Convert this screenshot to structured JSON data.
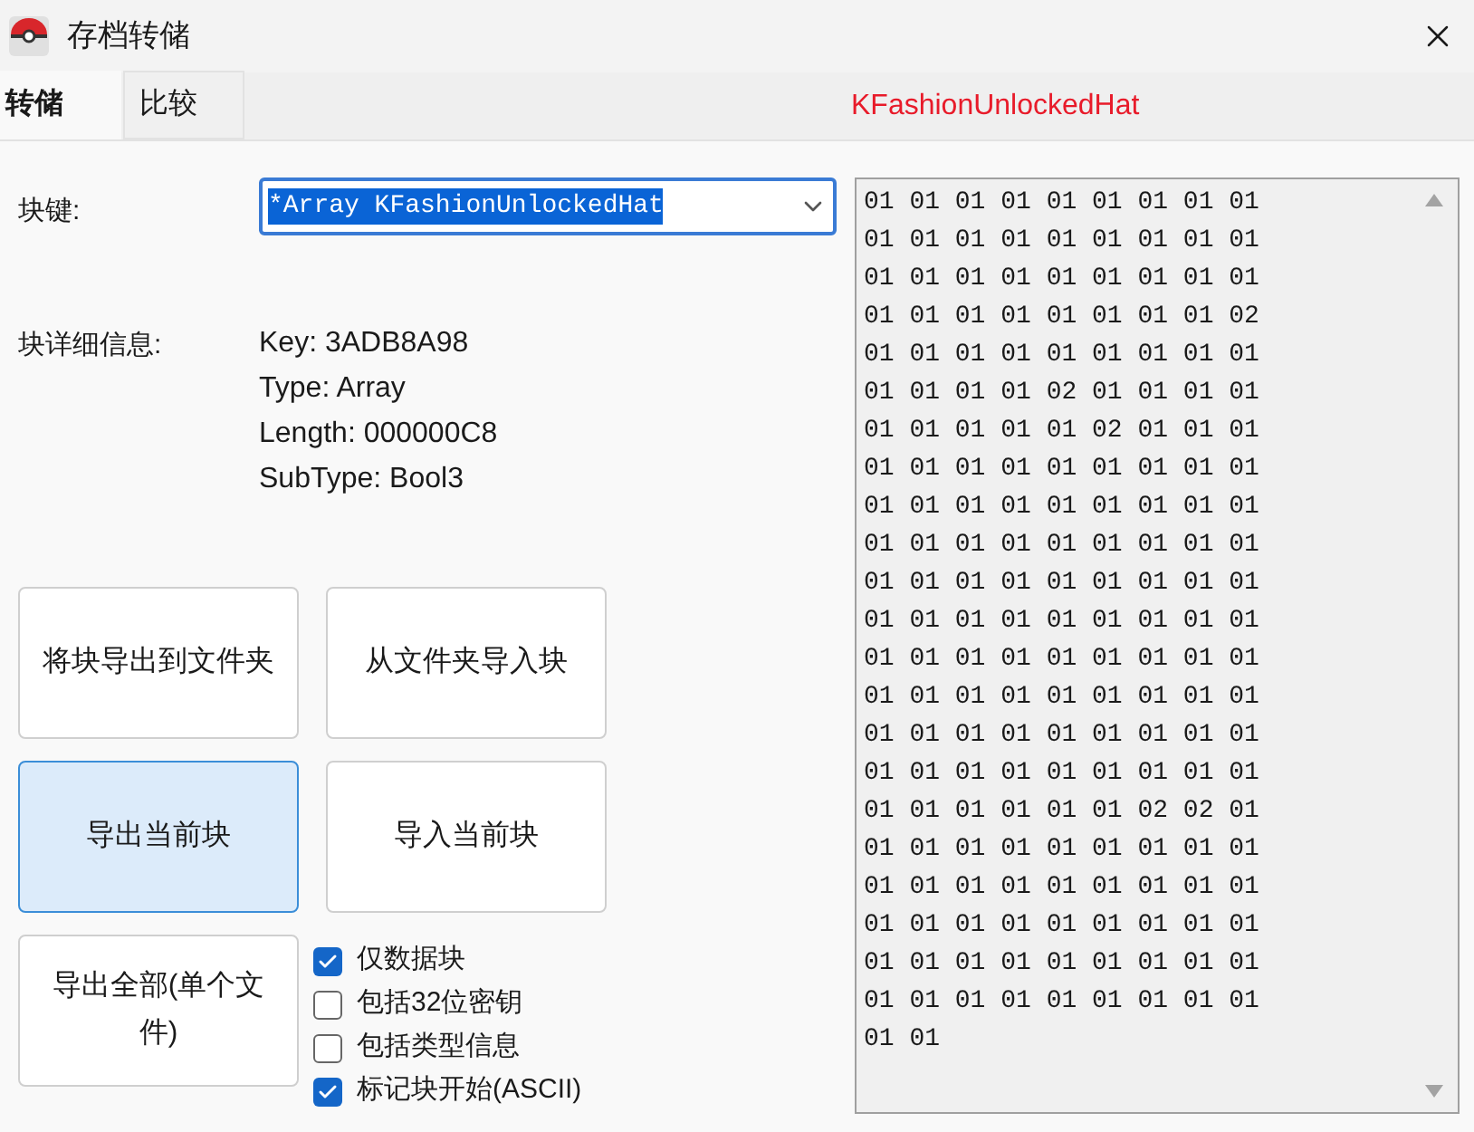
{
  "window": {
    "title": "存档转储"
  },
  "tabs": [
    {
      "label": "转储",
      "selected": true
    },
    {
      "label": "比较",
      "selected": false
    }
  ],
  "block_name": "KFashionUnlockedHat",
  "block_key": {
    "label": "块键:",
    "value": "*Array KFashionUnlockedHat"
  },
  "details": {
    "label": "块详细信息:",
    "lines": [
      "Key: 3ADB8A98",
      "Type: Array",
      "Length: 000000C8",
      "SubType: Bool3"
    ]
  },
  "buttons": [
    {
      "label": "将块导出到文件夹",
      "selected": false
    },
    {
      "label": "从文件夹导入块",
      "selected": false
    },
    {
      "label": "导出当前块",
      "selected": true
    },
    {
      "label": "导入当前块",
      "selected": false
    },
    {
      "label": "导出全部(单个文件)",
      "selected": false
    }
  ],
  "options": [
    {
      "label": "仅数据块",
      "checked": true
    },
    {
      "label": "包括32位密钥",
      "checked": false
    },
    {
      "label": "包括类型信息",
      "checked": false
    },
    {
      "label": "标记块开始(ASCII)",
      "checked": true
    }
  ],
  "hex_rows": [
    "01 01 01 01 01 01 01 01 01",
    "01 01 01 01 01 01 01 01 01",
    "01 01 01 01 01 01 01 01 01",
    "01 01 01 01 01 01 01 01 02",
    "01 01 01 01 01 01 01 01 01",
    "01 01 01 01 02 01 01 01 01",
    "01 01 01 01 01 02 01 01 01",
    "01 01 01 01 01 01 01 01 01",
    "01 01 01 01 01 01 01 01 01",
    "01 01 01 01 01 01 01 01 01",
    "01 01 01 01 01 01 01 01 01",
    "01 01 01 01 01 01 01 01 01",
    "01 01 01 01 01 01 01 01 01",
    "01 01 01 01 01 01 01 01 01",
    "01 01 01 01 01 01 01 01 01",
    "01 01 01 01 01 01 01 01 01",
    "01 01 01 01 01 01 02 02 01",
    "01 01 01 01 01 01 01 01 01",
    "01 01 01 01 01 01 01 01 01",
    "01 01 01 01 01 01 01 01 01",
    "01 01 01 01 01 01 01 01 01",
    "01 01 01 01 01 01 01 01 01",
    "01 01"
  ]
}
